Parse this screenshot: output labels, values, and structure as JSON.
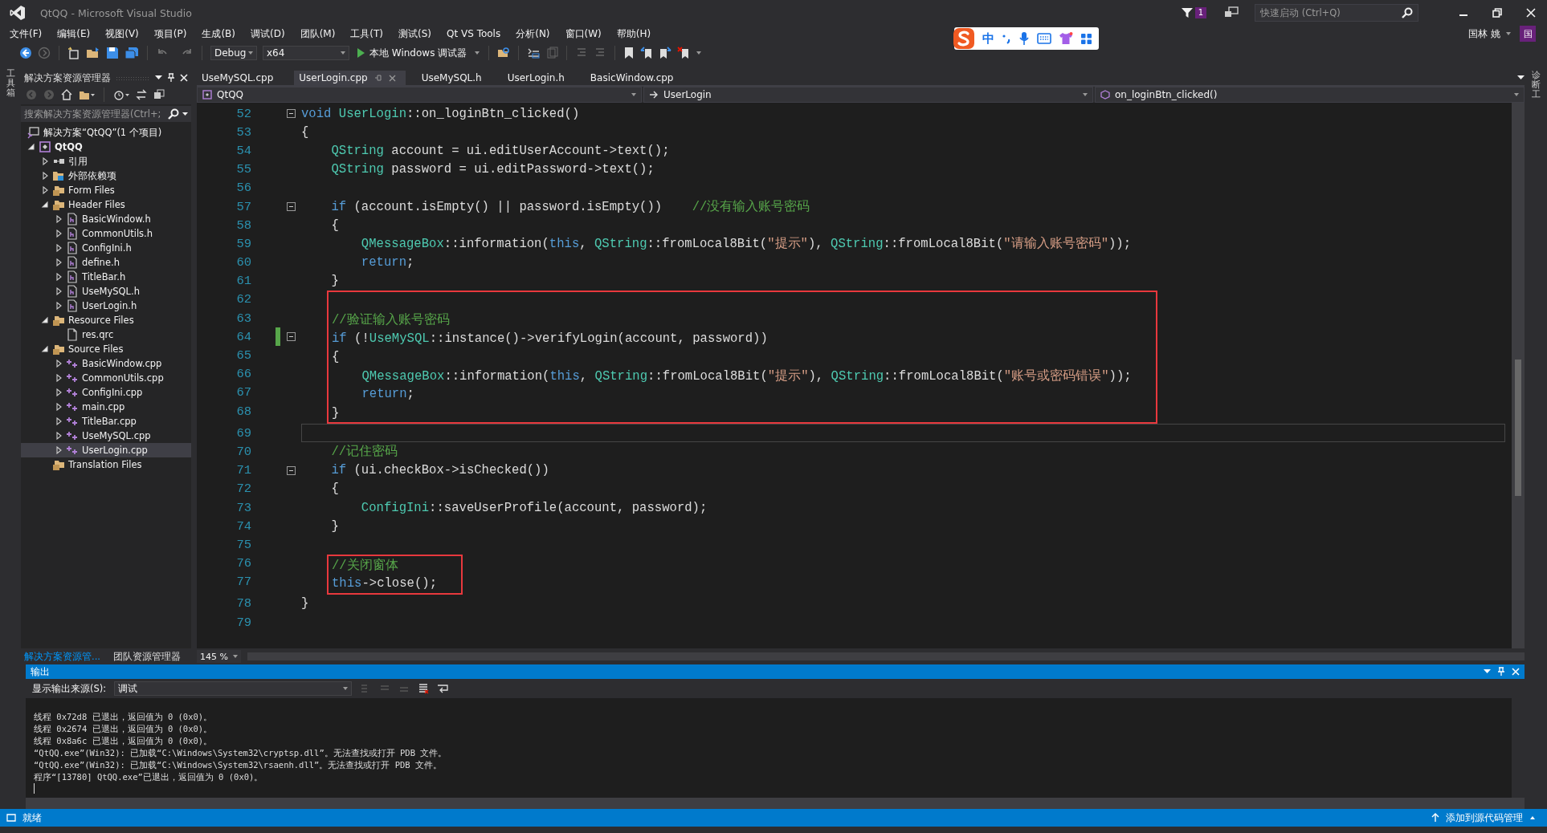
{
  "window": {
    "title": "QtQQ - Microsoft Visual Studio",
    "quick_launch_placeholder": "快速启动 (Ctrl+Q)",
    "notification_count": "1",
    "user_name": "国林 姚",
    "avatar_letter": "国"
  },
  "ime_toolbar": {
    "label": "中"
  },
  "menu": [
    "文件(F)",
    "编辑(E)",
    "视图(V)",
    "项目(P)",
    "生成(B)",
    "调试(D)",
    "团队(M)",
    "工具(T)",
    "测试(S)",
    "Qt VS Tools",
    "分析(N)",
    "窗口(W)",
    "帮助(H)"
  ],
  "toolbar": {
    "configuration": "Debug",
    "platform": "x64",
    "run_label": "本地 Windows 调试器"
  },
  "left_strip": {
    "label": "工具箱"
  },
  "right_strip": {
    "label": "诊断工"
  },
  "solution_explorer": {
    "title": "解决方案资源管理器",
    "search_placeholder": "搜索解决方案资源管理器(Ctrl+;",
    "solution_label": "解决方案“QtQQ”(1 个项目)",
    "tree": [
      {
        "label": "QtQQ",
        "kind": "project",
        "expandable": true,
        "expanded": true,
        "selected": false,
        "children": [
          {
            "label": "引用",
            "kind": "references",
            "expandable": true,
            "expanded": false,
            "selected": false
          },
          {
            "label": "外部依赖项",
            "kind": "external",
            "expandable": true,
            "expanded": false,
            "selected": false
          },
          {
            "label": "Form Files",
            "kind": "folder",
            "expandable": true,
            "expanded": false,
            "selected": false
          },
          {
            "label": "Header Files",
            "kind": "folder",
            "expandable": true,
            "expanded": true,
            "selected": false,
            "children": [
              {
                "label": "BasicWindow.h",
                "kind": "header",
                "expandable": true,
                "expanded": false,
                "selected": false
              },
              {
                "label": "CommonUtils.h",
                "kind": "header",
                "expandable": true,
                "expanded": false,
                "selected": false
              },
              {
                "label": "ConfigIni.h",
                "kind": "header",
                "expandable": true,
                "expanded": false,
                "selected": false
              },
              {
                "label": "define.h",
                "kind": "header",
                "expandable": true,
                "expanded": false,
                "selected": false
              },
              {
                "label": "TitleBar.h",
                "kind": "header",
                "expandable": true,
                "expanded": false,
                "selected": false
              },
              {
                "label": "UseMySQL.h",
                "kind": "header",
                "expandable": true,
                "expanded": false,
                "selected": false
              },
              {
                "label": "UserLogin.h",
                "kind": "header",
                "expandable": true,
                "expanded": false,
                "selected": false
              }
            ]
          },
          {
            "label": "Resource Files",
            "kind": "folder",
            "expandable": true,
            "expanded": true,
            "selected": false,
            "children": [
              {
                "label": "res.qrc",
                "kind": "file",
                "expandable": false,
                "expanded": false,
                "selected": false
              }
            ]
          },
          {
            "label": "Source Files",
            "kind": "folder",
            "expandable": true,
            "expanded": true,
            "selected": false,
            "children": [
              {
                "label": "BasicWindow.cpp",
                "kind": "source",
                "expandable": true,
                "expanded": false,
                "selected": false
              },
              {
                "label": "CommonUtils.cpp",
                "kind": "source",
                "expandable": true,
                "expanded": false,
                "selected": false
              },
              {
                "label": "ConfigIni.cpp",
                "kind": "source",
                "expandable": true,
                "expanded": false,
                "selected": false
              },
              {
                "label": "main.cpp",
                "kind": "source",
                "expandable": true,
                "expanded": false,
                "selected": false
              },
              {
                "label": "TitleBar.cpp",
                "kind": "source",
                "expandable": true,
                "expanded": false,
                "selected": false
              },
              {
                "label": "UseMySQL.cpp",
                "kind": "source",
                "expandable": true,
                "expanded": false,
                "selected": false
              },
              {
                "label": "UserLogin.cpp",
                "kind": "source",
                "expandable": true,
                "expanded": false,
                "selected": true
              }
            ]
          },
          {
            "label": "Translation Files",
            "kind": "folder",
            "expandable": false,
            "expanded": false,
            "selected": false
          }
        ]
      }
    ],
    "bottom_tabs": [
      {
        "label": "解决方案资源管...",
        "selected": true
      },
      {
        "label": "团队资源管理器",
        "selected": false
      }
    ]
  },
  "editor": {
    "tabs": [
      {
        "label": "UseMySQL.cpp",
        "selected": false
      },
      {
        "label": "UserLogin.cpp",
        "selected": true
      },
      {
        "label": "UseMySQL.h",
        "selected": false
      },
      {
        "label": "UserLogin.h",
        "selected": false
      },
      {
        "label": "BasicWindow.cpp",
        "selected": false
      }
    ],
    "nav": {
      "project": "QtQQ",
      "scope": "UserLogin",
      "member": "on_loginBtn_clicked()"
    },
    "zoom": "145 %",
    "code": [
      {
        "num": "52",
        "fold": true,
        "changed": false,
        "current": false,
        "boxed": false,
        "tokens": [
          {
            "kind": "keyword",
            "text": "void"
          },
          {
            "kind": "type",
            "text": " UserLogin"
          },
          {
            "kind": "plain",
            "text": "::on_loginBtn_clicked()"
          }
        ]
      },
      {
        "num": "53",
        "fold": false,
        "changed": false,
        "current": false,
        "boxed": false,
        "tokens": [
          {
            "kind": "plain",
            "text": "{"
          }
        ]
      },
      {
        "num": "54",
        "fold": false,
        "changed": false,
        "current": false,
        "boxed": false,
        "tokens": [
          {
            "kind": "type",
            "text": "    QString"
          },
          {
            "kind": "plain",
            "text": " account = ui.editUserAccount->text();"
          }
        ]
      },
      {
        "num": "55",
        "fold": false,
        "changed": false,
        "current": false,
        "boxed": false,
        "tokens": [
          {
            "kind": "type",
            "text": "    QString"
          },
          {
            "kind": "plain",
            "text": " password = ui.editPassword->text();"
          }
        ]
      },
      {
        "num": "56",
        "fold": false,
        "changed": false,
        "current": false,
        "boxed": false
      },
      {
        "num": "57",
        "fold": true,
        "changed": false,
        "current": false,
        "boxed": false,
        "tokens": [
          {
            "kind": "keyword",
            "text": "    if"
          },
          {
            "kind": "plain",
            "text": " (account.isEmpty() || password.isEmpty())    "
          },
          {
            "kind": "comment",
            "text": "//没有输入账号密码"
          }
        ]
      },
      {
        "num": "58",
        "fold": false,
        "changed": false,
        "current": false,
        "boxed": false,
        "tokens": [
          {
            "kind": "plain",
            "text": "    {"
          }
        ]
      },
      {
        "num": "59",
        "fold": false,
        "changed": false,
        "current": false,
        "boxed": false,
        "tokens": [
          {
            "kind": "type",
            "text": "        QMessageBox"
          },
          {
            "kind": "plain",
            "text": "::information("
          },
          {
            "kind": "keyword",
            "text": "this"
          },
          {
            "kind": "plain",
            "text": ", "
          },
          {
            "kind": "type",
            "text": "QString"
          },
          {
            "kind": "plain",
            "text": "::fromLocal8Bit("
          },
          {
            "kind": "string",
            "text": "\"提示\""
          },
          {
            "kind": "plain",
            "text": "), "
          },
          {
            "kind": "type",
            "text": "QString"
          },
          {
            "kind": "plain",
            "text": "::fromLocal8Bit("
          },
          {
            "kind": "string",
            "text": "\"请输入账号密码\""
          },
          {
            "kind": "plain",
            "text": "));"
          }
        ]
      },
      {
        "num": "60",
        "fold": false,
        "changed": false,
        "current": false,
        "boxed": false,
        "tokens": [
          {
            "kind": "keyword",
            "text": "        return"
          },
          {
            "kind": "plain",
            "text": ";"
          }
        ]
      },
      {
        "num": "61",
        "fold": false,
        "changed": false,
        "current": false,
        "boxed": false,
        "tokens": [
          {
            "kind": "plain",
            "text": "    }"
          }
        ]
      },
      {
        "num": "62",
        "fold": false,
        "changed": false,
        "current": false,
        "boxed": true
      },
      {
        "num": "63",
        "fold": false,
        "changed": false,
        "current": false,
        "boxed": true,
        "tokens": [
          {
            "kind": "comment",
            "text": "    //验证输入账号密码"
          }
        ]
      },
      {
        "num": "64",
        "fold": true,
        "changed": true,
        "current": false,
        "boxed": true,
        "tokens": [
          {
            "kind": "keyword",
            "text": "    if"
          },
          {
            "kind": "plain",
            "text": " (!"
          },
          {
            "kind": "type",
            "text": "UseMySQL"
          },
          {
            "kind": "plain",
            "text": "::instance()->verifyLogin(account, password))"
          }
        ]
      },
      {
        "num": "65",
        "fold": false,
        "changed": false,
        "current": false,
        "boxed": true,
        "tokens": [
          {
            "kind": "plain",
            "text": "    {"
          }
        ]
      },
      {
        "num": "66",
        "fold": false,
        "changed": false,
        "current": false,
        "boxed": true,
        "tokens": [
          {
            "kind": "type",
            "text": "        QMessageBox"
          },
          {
            "kind": "plain",
            "text": "::information("
          },
          {
            "kind": "keyword",
            "text": "this"
          },
          {
            "kind": "plain",
            "text": ", "
          },
          {
            "kind": "type",
            "text": "QString"
          },
          {
            "kind": "plain",
            "text": "::fromLocal8Bit("
          },
          {
            "kind": "string",
            "text": "\"提示\""
          },
          {
            "kind": "plain",
            "text": "), "
          },
          {
            "kind": "type",
            "text": "QString"
          },
          {
            "kind": "plain",
            "text": "::fromLocal8Bit("
          },
          {
            "kind": "string",
            "text": "\"账号或密码错误\""
          },
          {
            "kind": "plain",
            "text": "));"
          }
        ]
      },
      {
        "num": "67",
        "fold": false,
        "changed": false,
        "current": false,
        "boxed": true,
        "tokens": [
          {
            "kind": "keyword",
            "text": "        return"
          },
          {
            "kind": "plain",
            "text": ";"
          }
        ]
      },
      {
        "num": "68",
        "fold": false,
        "changed": false,
        "current": false,
        "boxed": true,
        "tokens": [
          {
            "kind": "plain",
            "text": "    }"
          }
        ]
      },
      {
        "num": "69",
        "fold": false,
        "changed": false,
        "current": true,
        "boxed": false
      },
      {
        "num": "70",
        "fold": false,
        "changed": false,
        "current": false,
        "boxed": false,
        "tokens": [
          {
            "kind": "comment",
            "text": "    //记住密码"
          }
        ]
      },
      {
        "num": "71",
        "fold": true,
        "changed": false,
        "current": false,
        "boxed": false,
        "tokens": [
          {
            "kind": "keyword",
            "text": "    if"
          },
          {
            "kind": "plain",
            "text": " (ui.checkBox->isChecked())"
          }
        ]
      },
      {
        "num": "72",
        "fold": false,
        "changed": false,
        "current": false,
        "boxed": false,
        "tokens": [
          {
            "kind": "plain",
            "text": "    {"
          }
        ]
      },
      {
        "num": "73",
        "fold": false,
        "changed": false,
        "current": false,
        "boxed": false,
        "tokens": [
          {
            "kind": "type",
            "text": "        ConfigIni"
          },
          {
            "kind": "plain",
            "text": "::saveUserProfile(account, password);"
          }
        ]
      },
      {
        "num": "74",
        "fold": false,
        "changed": false,
        "current": false,
        "boxed": false,
        "tokens": [
          {
            "kind": "plain",
            "text": "    }"
          }
        ]
      },
      {
        "num": "75",
        "fold": false,
        "changed": false,
        "current": false,
        "boxed": false
      },
      {
        "num": "76",
        "fold": false,
        "changed": false,
        "current": false,
        "boxed": true,
        "tokens": [
          {
            "kind": "comment",
            "text": "    //关闭窗体"
          }
        ]
      },
      {
        "num": "77",
        "fold": false,
        "changed": false,
        "current": false,
        "boxed": true,
        "tokens": [
          {
            "kind": "keyword",
            "text": "    this"
          },
          {
            "kind": "plain",
            "text": "->close();"
          }
        ]
      },
      {
        "num": "78",
        "fold": false,
        "changed": false,
        "current": false,
        "boxed": false,
        "tokens": [
          {
            "kind": "plain",
            "text": "}"
          }
        ]
      },
      {
        "num": "79",
        "fold": false,
        "changed": false,
        "current": false,
        "boxed": false
      }
    ]
  },
  "output": {
    "title": "输出",
    "source_label": "显示输出来源(S):",
    "source_value": "调试",
    "lines": [
      "线程 0x72d8 已退出，返回值为 0 (0x0)。",
      "线程 0x2674 已退出，返回值为 0 (0x0)。",
      "线程 0x8a6c 已退出，返回值为 0 (0x0)。",
      "“QtQQ.exe”(Win32): 已加载“C:\\Windows\\System32\\cryptsp.dll”。无法查找或打开 PDB 文件。",
      "“QtQQ.exe”(Win32): 已加载“C:\\Windows\\System32\\rsaenh.dll”。无法查找或打开 PDB 文件。",
      "程序“[13780] QtQQ.exe”已退出，返回值为 0 (0x0)。"
    ]
  },
  "status_bar": {
    "state": "就绪",
    "source_control": "添加到源代码管理"
  }
}
